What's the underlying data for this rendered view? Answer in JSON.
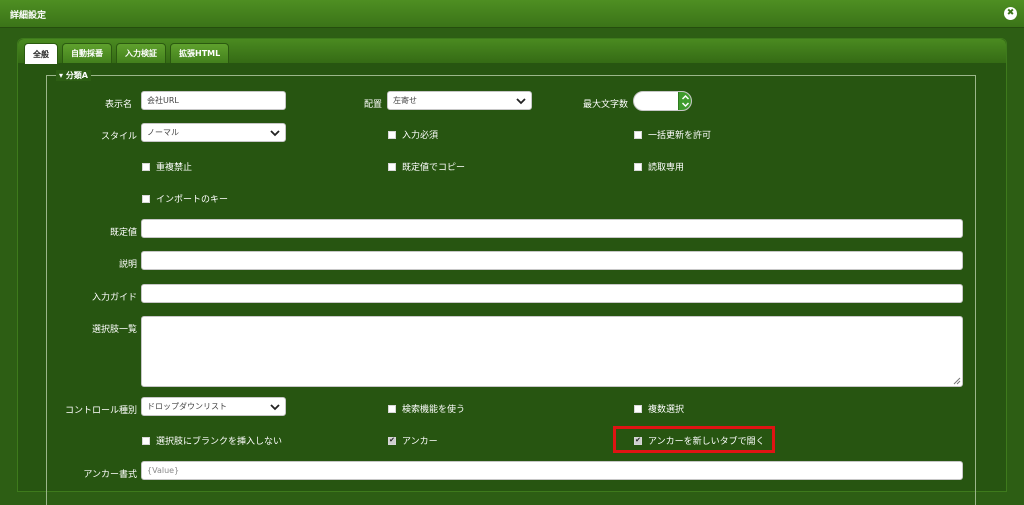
{
  "window": {
    "title": "詳細設定",
    "close_icon": "close-icon"
  },
  "tabs": [
    {
      "label": "全般",
      "active": true
    },
    {
      "label": "自動採番",
      "active": false
    },
    {
      "label": "入力検証",
      "active": false
    },
    {
      "label": "拡張HTML",
      "active": false
    }
  ],
  "section": {
    "legend": "分類A"
  },
  "form": {
    "display_name": {
      "label": "表示名",
      "value": "会社URL"
    },
    "layout": {
      "label": "配置",
      "value": "左寄せ"
    },
    "max_chars": {
      "label": "最大文字数",
      "value": ""
    },
    "style": {
      "label": "スタイル",
      "value": "ノーマル"
    },
    "required": {
      "label": "入力必須",
      "checked": false
    },
    "bulk_update": {
      "label": "一括更新を許可",
      "checked": false
    },
    "no_duplicates": {
      "label": "重複禁止",
      "checked": false
    },
    "copy_default": {
      "label": "既定値でコピー",
      "checked": false
    },
    "readonly": {
      "label": "読取専用",
      "checked": false
    },
    "import_key": {
      "label": "インポートのキー",
      "checked": false
    },
    "default_value": {
      "label": "既定値",
      "value": ""
    },
    "description": {
      "label": "説明",
      "value": ""
    },
    "input_guide": {
      "label": "入力ガイド",
      "value": ""
    },
    "choices": {
      "label": "選択肢一覧",
      "value": ""
    },
    "control_type": {
      "label": "コントロール種別",
      "value": "ドロップダウンリスト"
    },
    "use_search": {
      "label": "検索機能を使う",
      "checked": false
    },
    "multi_select": {
      "label": "複数選択",
      "checked": false
    },
    "no_blank_choice": {
      "label": "選択肢にブランクを挿入しない",
      "checked": false
    },
    "anchor": {
      "label": "アンカー",
      "checked": true
    },
    "anchor_new_tab": {
      "label": "アンカーを新しいタブで開く",
      "checked": true
    },
    "anchor_format": {
      "label": "アンカー書式",
      "placeholder": "{Value}"
    }
  },
  "colors": {
    "background": "#2d5e14",
    "tab_active": "#ffffff",
    "highlight": "#e01313",
    "spinner_accent": "#3f9a2c"
  }
}
